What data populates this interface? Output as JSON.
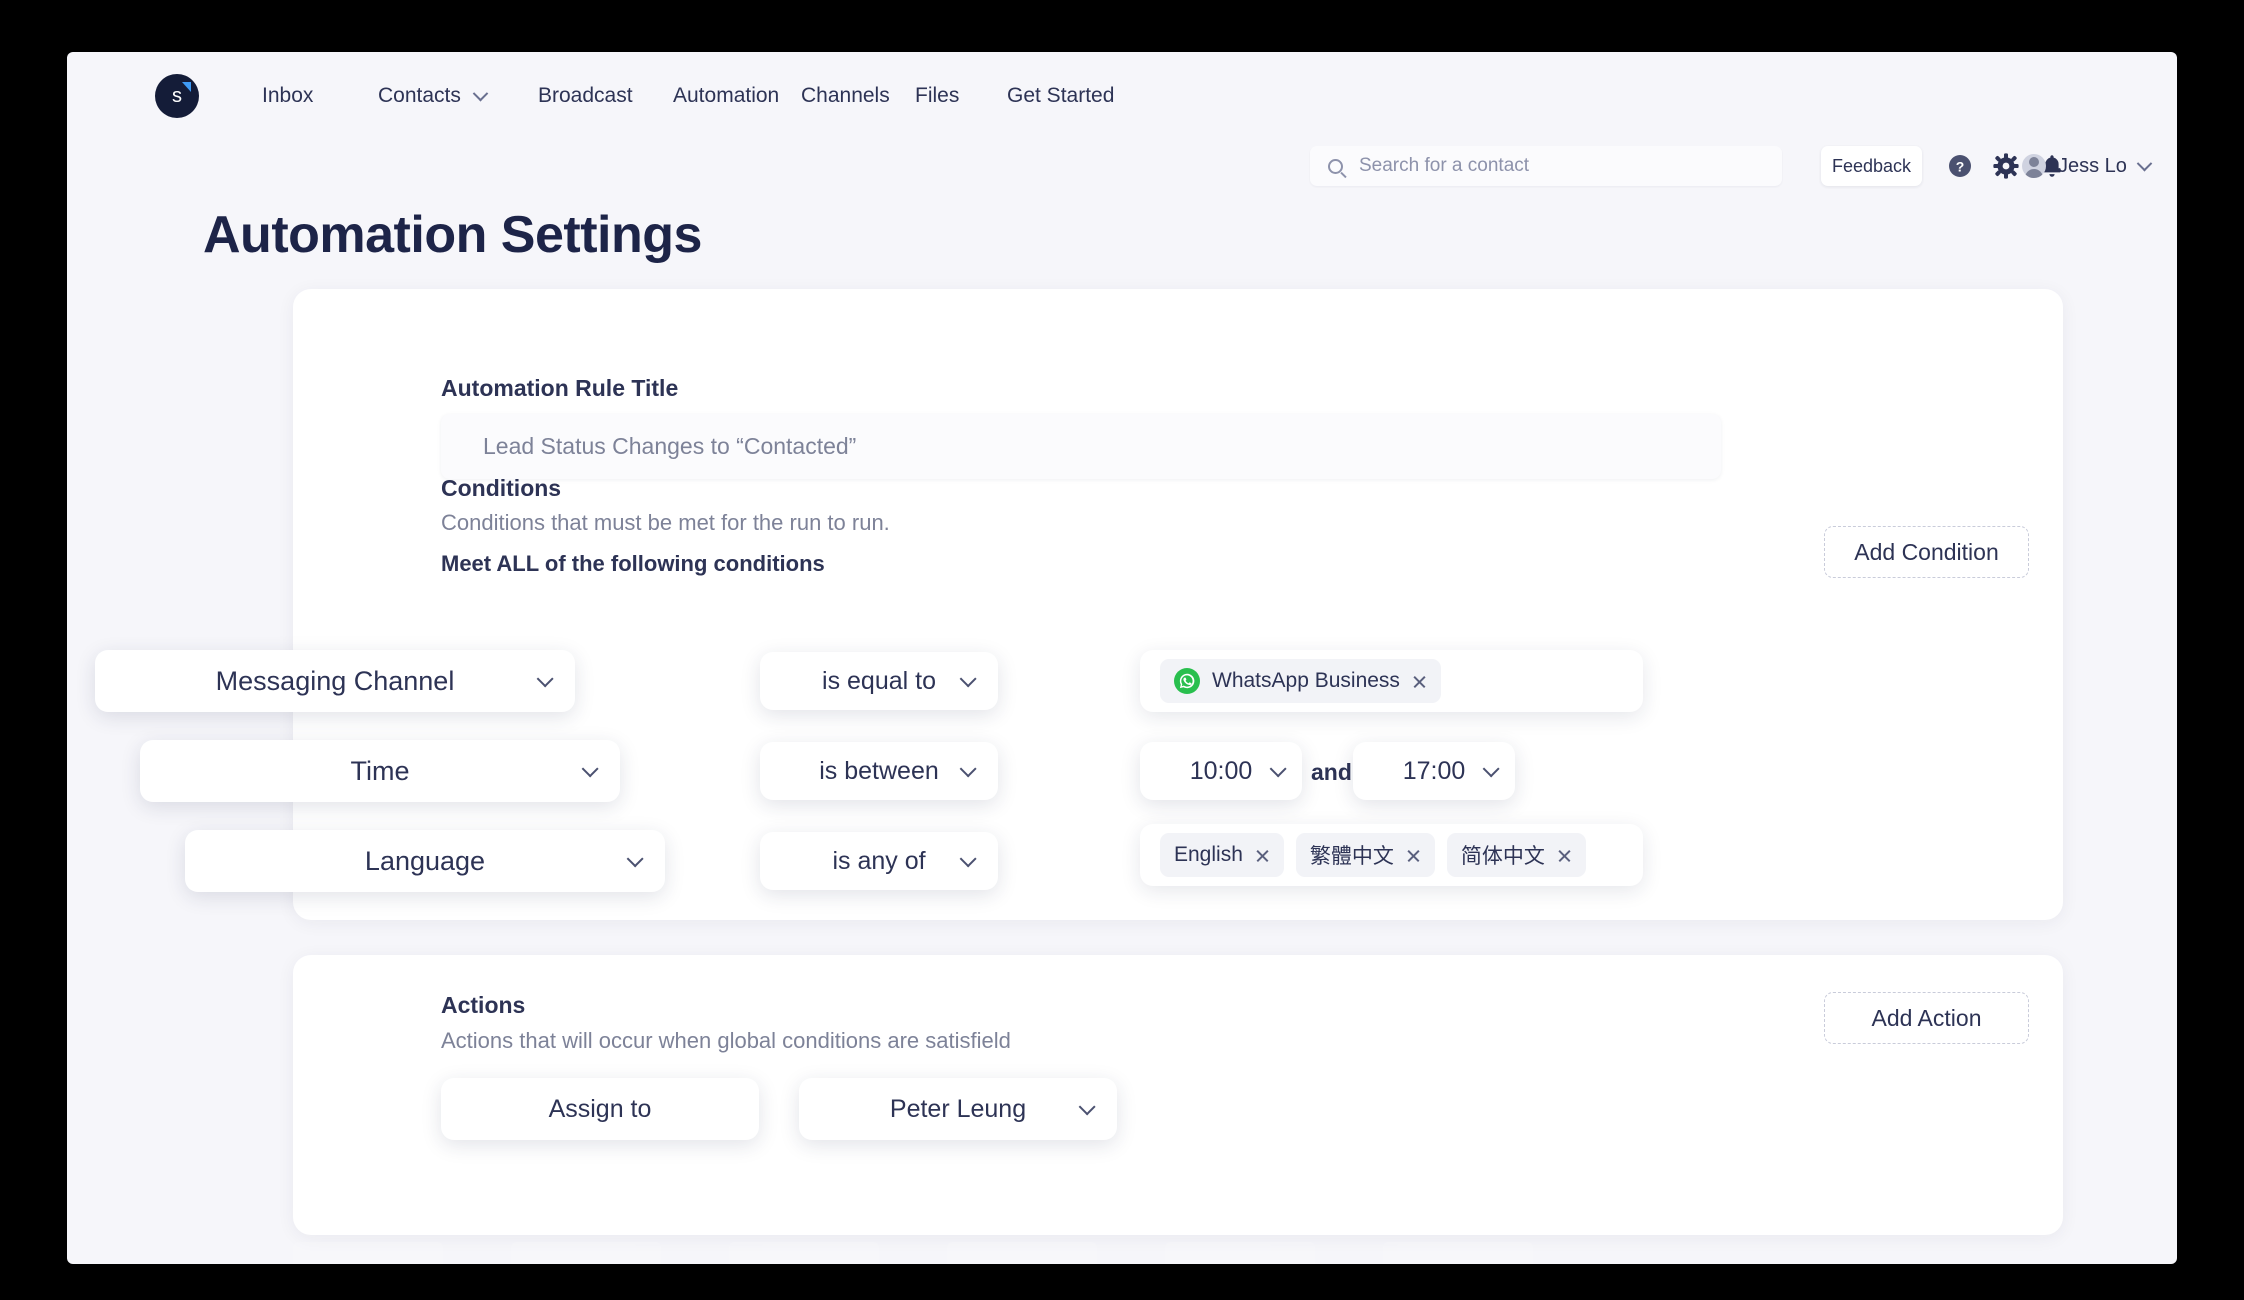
{
  "nav": {
    "logo_letter": "s",
    "links": [
      {
        "label": "Inbox",
        "has_chevron": false
      },
      {
        "label": "Contacts",
        "has_chevron": true
      },
      {
        "label": "Broadcast",
        "has_chevron": false
      },
      {
        "label": "Automation",
        "has_chevron": false
      },
      {
        "label": "Channels",
        "has_chevron": false
      },
      {
        "label": "Files",
        "has_chevron": false
      },
      {
        "label": "Get Started",
        "has_chevron": false
      }
    ],
    "search_placeholder": "Search for a contact",
    "feedback_label": "Feedback",
    "icons": [
      "help-circle-icon",
      "gear-icon",
      "bell-icon"
    ],
    "user_name": "Jess Lo"
  },
  "page": {
    "title": "Automation Settings"
  },
  "rule": {
    "title_label": "Automation Rule Title",
    "title_value": "Lead Status Changes to “Contacted”",
    "title_placeholder": "Lead Status Changes to “Contacted”"
  },
  "conditions": {
    "heading": "Conditions",
    "subheading": "Conditions that must be met for the run to run.",
    "match_mode_label": "Meet ALL of the following conditions",
    "add_button": "Add Condition",
    "rows": [
      {
        "field": "Messaging Channel",
        "operator": "is equal to",
        "value_type": "chips",
        "chips": [
          {
            "label": "WhatsApp Business",
            "icon": "whatsapp-icon"
          }
        ]
      },
      {
        "field": "Time",
        "operator": "is between",
        "value_type": "time-range",
        "from": "10:00",
        "conjunction": "and",
        "to": "17:00"
      },
      {
        "field": "Language",
        "operator": "is any of",
        "value_type": "chips",
        "chips": [
          {
            "label": "English",
            "icon": null
          },
          {
            "label": "繁體中文",
            "icon": null
          },
          {
            "label": "简体中文",
            "icon": null
          }
        ]
      }
    ]
  },
  "actions": {
    "heading": "Actions",
    "subheading": "Actions that will occur when global conditions are satisfield",
    "add_button": "Add Action",
    "rows": [
      {
        "action": "Assign to",
        "target": "Peter Leung"
      }
    ]
  },
  "colors": {
    "page_bg": "#f6f6fa",
    "card_bg": "#ffffff",
    "text_primary": "#2d3355",
    "text_muted": "#7d8298",
    "title": "#1d2448",
    "logo_bg": "#141c38",
    "logo_accent": "#3f9bf5",
    "whatsapp_green": "#29bf4e",
    "chip_bg": "#f2f3f7"
  }
}
